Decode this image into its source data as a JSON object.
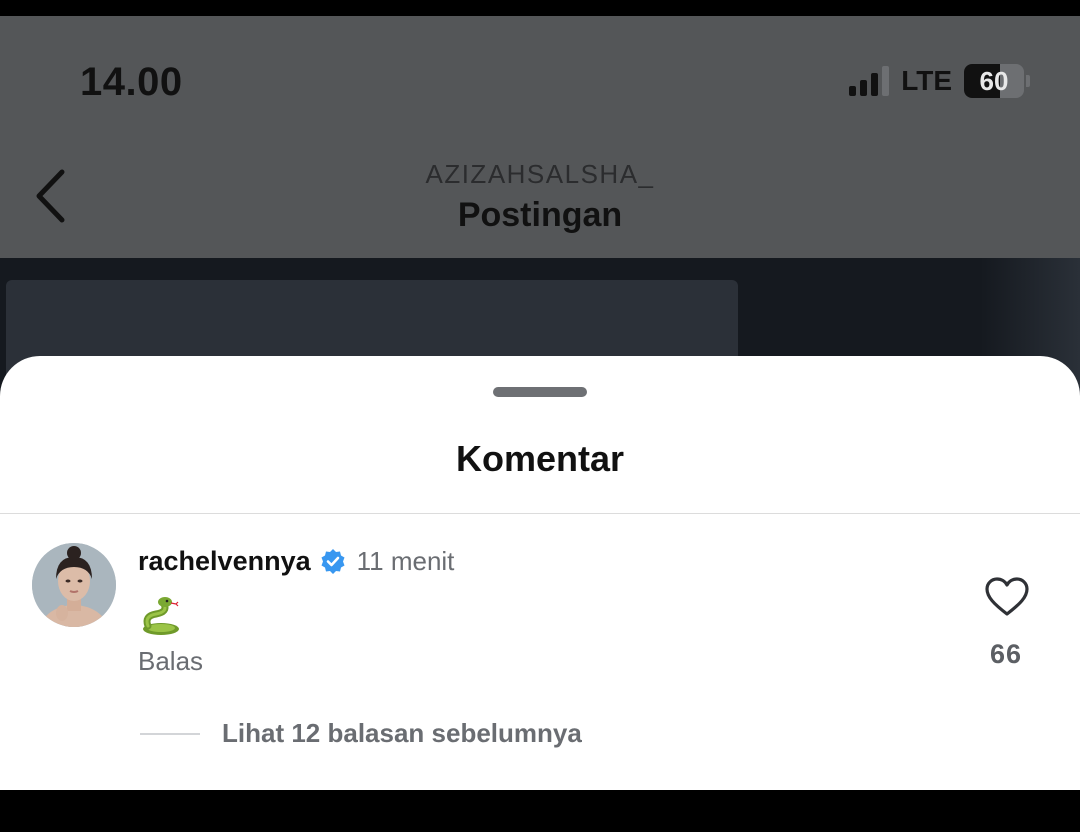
{
  "status_bar": {
    "time": "14.00",
    "network": "LTE",
    "battery": "60"
  },
  "header": {
    "username": "AZIZAHSALSHA_",
    "title": "Postingan"
  },
  "comments_sheet": {
    "title": "Komentar",
    "comment": {
      "username": "rachelvennya",
      "verified": true,
      "time_ago": "11 menit",
      "content_emoji": "snake-emoji",
      "reply_label": "Balas",
      "likes": "66"
    },
    "view_replies": "Lihat 12 balasan sebelumnya"
  },
  "colors": {
    "verified_badge": "#3897f0",
    "text_primary": "#111111",
    "text_secondary": "#6a6d72",
    "dim_overlay": "#545658"
  }
}
